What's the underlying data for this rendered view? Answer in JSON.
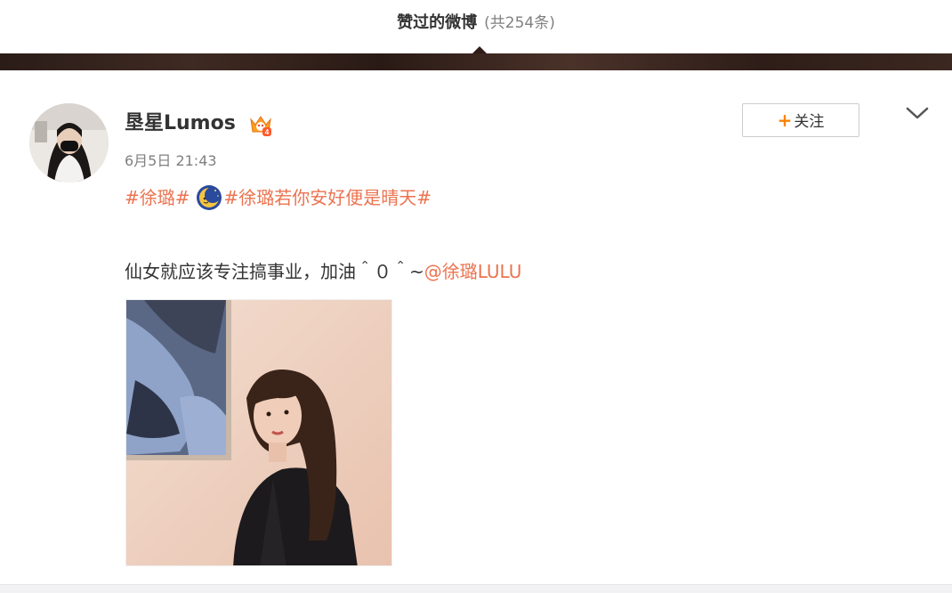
{
  "header": {
    "title": "赞过的微博",
    "count_text": "(共254条)"
  },
  "post": {
    "author": {
      "name": "垦星Lumos",
      "badge_icon": "vip-crown-icon"
    },
    "timestamp": "6月5日 21:43",
    "follow_button": {
      "plus": "+",
      "label": "关注"
    },
    "more_icon": "chevron-down-icon",
    "topics": [
      {
        "text": "#徐璐#"
      },
      {
        "text": "#徐璐若你安好便是晴天#",
        "emoji_icon": "moon-emoji-icon"
      }
    ],
    "body": {
      "text": "仙女就应该专注搞事业，加油＾０＾~",
      "mention": "@徐璐LULU"
    },
    "image": {
      "semantic": "photo of woman with long hair in black jacket beside abstract painting"
    }
  },
  "colors": {
    "link": "#eb7350",
    "follow_plus": "#ff8200",
    "text": "#333333",
    "muted": "#808080",
    "banner": "#2e1d18"
  }
}
